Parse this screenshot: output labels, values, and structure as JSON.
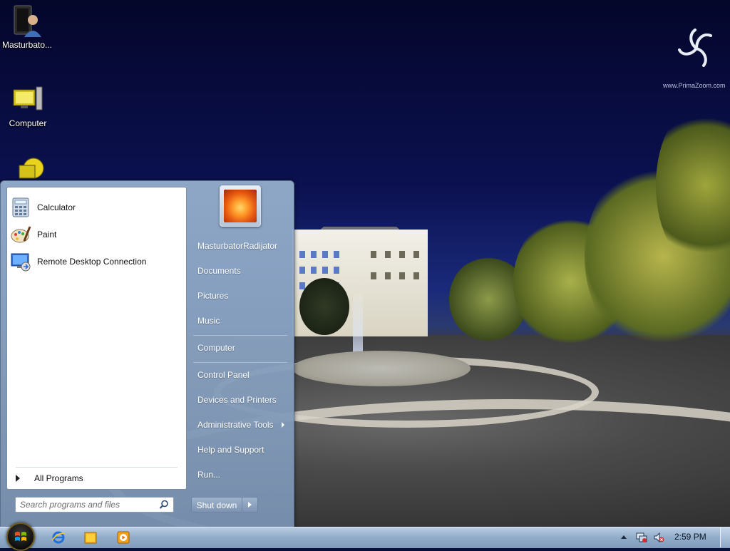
{
  "desktop": {
    "icons": [
      {
        "label": "Masturbato...",
        "icon": "user-folder-icon"
      },
      {
        "label": "Computer",
        "icon": "computer-icon"
      },
      {
        "label": "",
        "icon": "network-icon"
      }
    ],
    "wallpaper_watermark": "www.PrimaZoom.com"
  },
  "start_menu": {
    "programs": [
      {
        "label": "Calculator",
        "icon": "calculator-icon"
      },
      {
        "label": "Paint",
        "icon": "paint-icon"
      },
      {
        "label": "Remote Desktop Connection",
        "icon": "remote-desktop-icon"
      }
    ],
    "all_programs_label": "All Programs",
    "search_placeholder": "Search programs and files",
    "right_items": [
      {
        "label": "MasturbatorRadijator"
      },
      {
        "label": "Documents"
      },
      {
        "label": "Pictures"
      },
      {
        "label": "Music"
      },
      {
        "label": "Computer"
      },
      {
        "label": "Control Panel"
      },
      {
        "label": "Devices and Printers"
      },
      {
        "label": "Administrative Tools",
        "has_submenu": true
      },
      {
        "label": "Help and Support"
      },
      {
        "label": "Run..."
      }
    ],
    "shutdown_label": "Shut down"
  },
  "taskbar": {
    "pinned": [
      {
        "icon": "internet-explorer-icon"
      },
      {
        "icon": "explorer-folder-icon"
      },
      {
        "icon": "media-player-icon"
      }
    ],
    "tray_icons": [
      "network-icon",
      "volume-muted-icon"
    ],
    "clock": "2:59 PM"
  },
  "colors": {
    "menu_accent": "#8ea6c4",
    "taskbar": "#93aecb"
  }
}
